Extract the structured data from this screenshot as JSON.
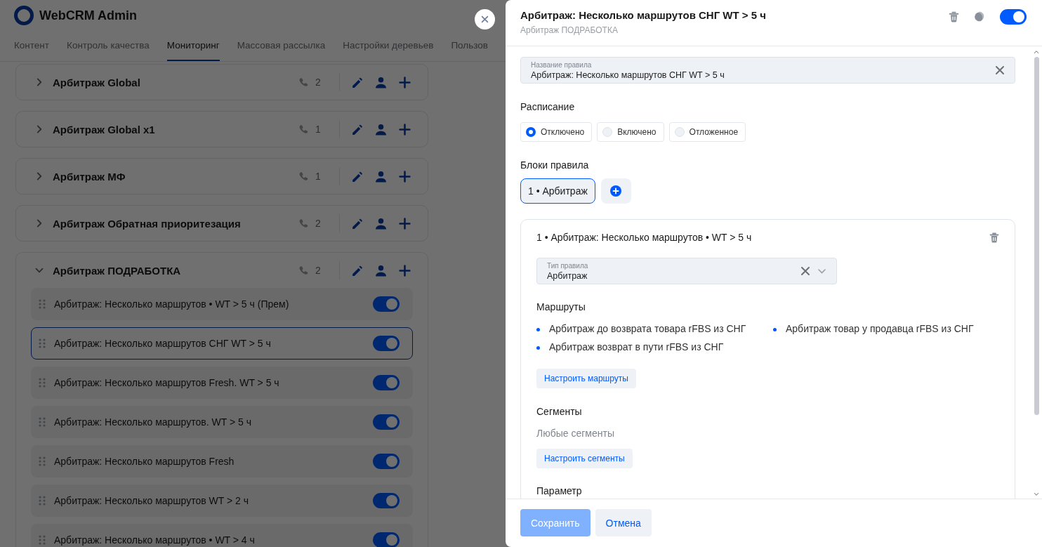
{
  "app": {
    "title": "WebCRM Admin"
  },
  "nav_tabs": [
    {
      "label": "Контент",
      "selected": false
    },
    {
      "label": "Контроль качества",
      "selected": false
    },
    {
      "label": "Мониторинг",
      "selected": true
    },
    {
      "label": "Массовая рассылка",
      "selected": false
    },
    {
      "label": "Настройки деревьев",
      "selected": false
    },
    {
      "label": "Пользов",
      "selected": false
    }
  ],
  "groups": [
    {
      "title": "Арбитраж Global",
      "calls": "2",
      "expanded": false
    },
    {
      "title": "Арбитраж Global x1",
      "calls": "1",
      "expanded": false
    },
    {
      "title": "Арбитраж МФ",
      "calls": "1",
      "expanded": false
    },
    {
      "title": "Арбитраж Обратная приоритезация",
      "calls": "2",
      "expanded": false
    },
    {
      "title": "Арбитраж ПОДРАБОТКА",
      "calls": "2",
      "expanded": true,
      "rules": [
        {
          "name": "Арбитраж: Несколько маршрутов • WT > 5 ч (Прем)",
          "selected": false,
          "on": true
        },
        {
          "name": "Арбитраж: Несколько маршрутов СНГ WT > 5 ч",
          "selected": true,
          "on": true
        },
        {
          "name": "Арбитраж: Несколько маршрутов Fresh. WT > 5 ч",
          "selected": false,
          "on": true
        },
        {
          "name": "Арбитраж: Несколько маршрутов. WT > 5 ч",
          "selected": false,
          "on": true
        },
        {
          "name": "Арбитраж: Несколько маршрутов Fresh",
          "selected": false,
          "on": true
        },
        {
          "name": "Арбитраж: Несколько маршрутов WT > 2 ч",
          "selected": false,
          "on": true
        },
        {
          "name": "Арбитраж: Несколько маршрутов • WT > 4 ч",
          "selected": false,
          "on": true
        }
      ]
    }
  ],
  "drawer": {
    "title": "Арбитраж: Несколько маршрутов СНГ WT > 5 ч",
    "subtitle": "Арбитраж ПОДРАБОТКА",
    "enabled": true,
    "name_field": {
      "label": "Название правила",
      "value": "Арбитраж: Несколько маршрутов СНГ WT > 5 ч"
    },
    "schedule": {
      "label": "Расписание",
      "options": [
        {
          "label": "Отключено",
          "selected": true
        },
        {
          "label": "Включено",
          "selected": false
        },
        {
          "label": "Отложенное",
          "selected": false
        }
      ]
    },
    "blocks": {
      "label": "Блоки правила",
      "tabs": [
        {
          "label": "1 • Арбитраж",
          "selected": true
        }
      ]
    },
    "block": {
      "title": "1 • Арбитраж: Несколько маршрутов • WT > 5 ч",
      "type_field": {
        "label": "Тип правила",
        "value": "Арбитраж"
      },
      "routes": {
        "label": "Маршруты",
        "items": [
          "Арбитраж до возврата товара rFBS из СНГ",
          "Арбитраж возврат в пути rFBS из СНГ",
          "Арбитраж товар у продавца rFBS из СНГ"
        ],
        "button": "Настроить маршруты"
      },
      "segments": {
        "label": "Сегменты",
        "value": "Любые сегменты",
        "button": "Настроить сегменты"
      },
      "parameter": {
        "label": "Параметр"
      }
    }
  },
  "footer": {
    "save": "Сохранить",
    "save_disabled": true,
    "cancel": "Отмена"
  }
}
